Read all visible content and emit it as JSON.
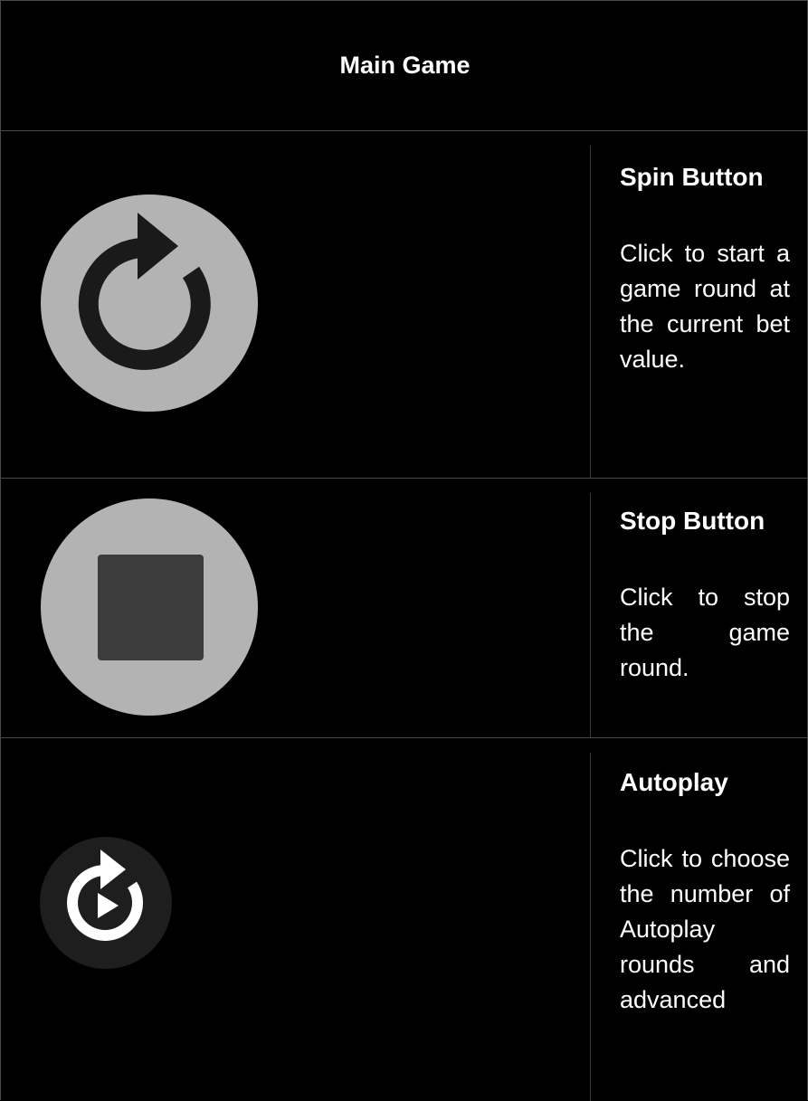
{
  "header": {
    "title": "Main Game"
  },
  "items": [
    {
      "icon": "spin-icon",
      "title": "Spin Button",
      "description": "Click to start a game round at the current bet value."
    },
    {
      "icon": "stop-icon",
      "title": "Stop Button",
      "description": "Click to stop the game round."
    },
    {
      "icon": "autoplay-icon",
      "title": "Autoplay",
      "description": "Click to choose the number of Autoplay rounds and advanced"
    }
  ],
  "colors": {
    "background": "#000000",
    "text": "#ffffff",
    "divider": "#4a4a4a",
    "button_circle": "#b3b3b3",
    "button_glyph": "#1a1a1a",
    "stop_square": "#3c3c3c",
    "autoplay_circle": "#1e1e1e",
    "autoplay_glyph": "#ffffff"
  }
}
